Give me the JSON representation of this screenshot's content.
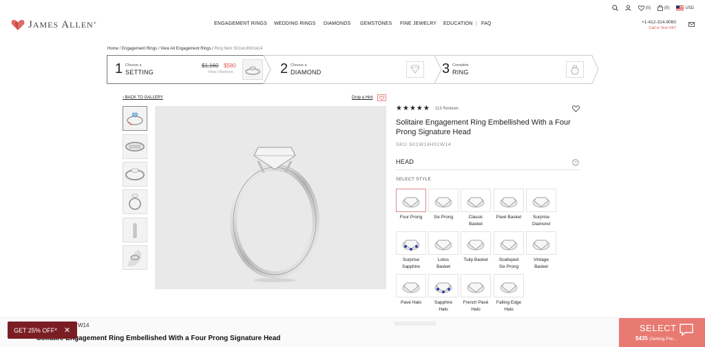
{
  "brand": {
    "name_first": "J",
    "name_rest": "AMES ",
    "name_first2": "A",
    "name_rest2": "LLEN",
    "reg": "®"
  },
  "nav": [
    "ENGAGEMENT RINGS",
    "WEDDING RINGS",
    "DIAMONDS",
    "GEMSTONES",
    "FINE JEWELRY",
    "EDUCATION",
    "|",
    "FAQ"
  ],
  "utils": {
    "wishlist_count": "(0)",
    "cart_count": "(0)",
    "currency": "USD"
  },
  "contact": {
    "phone": "+1-412-314-9060",
    "sub": "Call or Text 24/7"
  },
  "breadcrumb": {
    "path": "Home / Engagement Rings / View All Engagement Rings / ",
    "current": "Ring Item S01w14h01w14"
  },
  "steps": [
    {
      "num": "1",
      "small": "Choose a",
      "big": "SETTING",
      "old_price": "$1,160",
      "new_price": "$580",
      "links": "View | Remove"
    },
    {
      "num": "2",
      "small": "Choose a",
      "big": "DIAMOND"
    },
    {
      "num": "3",
      "small": "Complete",
      "big": "RING"
    }
  ],
  "gallery": {
    "back": "BACK TO GALLERY",
    "hint": "Drop a Hint"
  },
  "product": {
    "rating_stars": 5,
    "reviews": "113 Reviews",
    "title": "Solitaire Engagement Ring Embellished With a Four Prong Signature Head",
    "sku": "SKU S01W14H01W14",
    "section": "HEAD",
    "select_style": "SELECT STYLE",
    "styles": [
      [
        "Four Prong"
      ],
      [
        "Six Prong"
      ],
      [
        "Classic",
        "Basket"
      ],
      [
        "Pavé Basket"
      ],
      [
        "Surprise",
        "Diamond"
      ],
      [
        "Surprise",
        "Sapphire"
      ],
      [
        "Lotus",
        "Basket"
      ],
      [
        "Tulip Basket"
      ],
      [
        "Scalloped",
        "Six Prong"
      ],
      [
        "Vintage",
        "Basket"
      ],
      [
        "Pavé Halo"
      ],
      [
        "Sapphire",
        "Halo"
      ],
      [
        "French Pavé",
        "Halo"
      ],
      [
        "Falling Edge",
        "Halo"
      ]
    ]
  },
  "bottom": {
    "promo": "GET 25% OFF*",
    "sku_fragment": "W14",
    "title": "Solitaire Engagement Ring Embellished With a Four Prong Signature Head",
    "select": "SELECT",
    "price": "$435",
    "price_note": "(Setting Pric..."
  }
}
